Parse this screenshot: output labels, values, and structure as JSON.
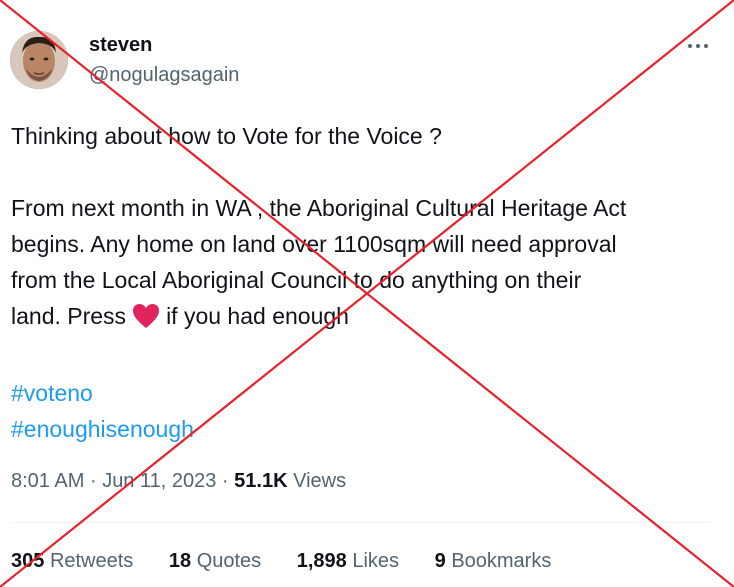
{
  "author": {
    "name": "steven",
    "handle": "@nogulagsagain"
  },
  "tweet": {
    "lines1": [
      "Thinking about how to Vote for the Voice ?"
    ],
    "lines2": [
      "From next month in WA , the Aboriginal Cultural Heritage Act",
      "begins. Any home on land over 1100sqm will need approval",
      "from the Local Aboriginal Council to do anything on their"
    ],
    "last_line_before": "land.  Press",
    "last_line_after": "if you had enough",
    "hashtags": [
      "#voteno",
      "#enoughisenough"
    ]
  },
  "meta": {
    "time": "8:01 AM",
    "dot": "·",
    "date": "Jun 11, 2023",
    "views_count": "51.1K",
    "views_label": "Views"
  },
  "stats": {
    "retweets_count": "305",
    "retweets_label": "Retweets",
    "quotes_count": "18",
    "quotes_label": "Quotes",
    "likes_count": "1,898",
    "likes_label": "Likes",
    "bookmarks_count": "9",
    "bookmarks_label": "Bookmarks"
  },
  "colors": {
    "text": "#0f1419",
    "secondary": "#536471",
    "link": "#1d9bf0",
    "heart": "#e0245e",
    "cross": "#e8202a"
  },
  "icons": {
    "more": "more-horizontal-icon",
    "heart": "red-heart-emoji"
  }
}
